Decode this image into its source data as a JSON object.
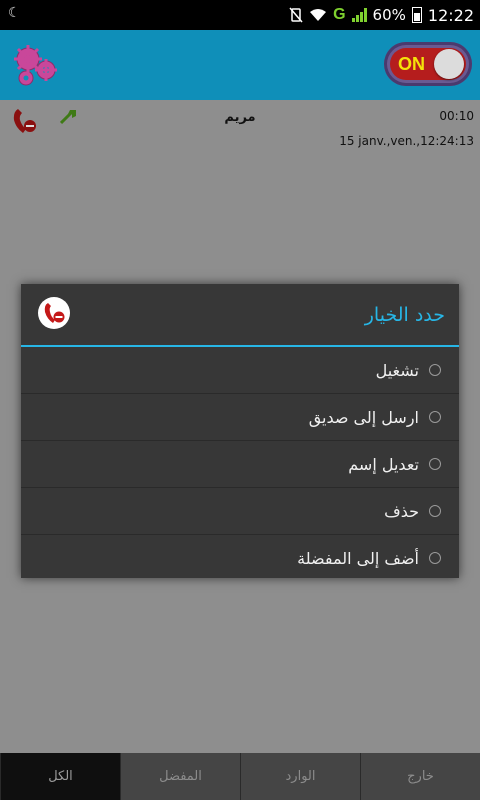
{
  "status_bar": {
    "left_icon": "moon-icon",
    "battery_percent": "60%",
    "network": "G",
    "time": "12:22"
  },
  "toolbar": {
    "switch_label": "ON",
    "switch_on": true,
    "settings_icon": "gears-icon"
  },
  "call": {
    "name": "مريم",
    "duration": "00:10",
    "datetime": "15 janv.,ven.,12:24:13"
  },
  "dialog": {
    "title": "حدد الخيار",
    "options": [
      {
        "label": "تشغيل"
      },
      {
        "label": "ارسل إلى صديق"
      },
      {
        "label": "تعديل إسم"
      },
      {
        "label": "حذف"
      },
      {
        "label": "أضف إلى المفضلة"
      }
    ]
  },
  "tabs": [
    {
      "label": "الكل",
      "active": true
    },
    {
      "label": "المفضل",
      "active": false
    },
    {
      "label": "الوارد",
      "active": false
    },
    {
      "label": "خارج",
      "active": false
    }
  ],
  "colors": {
    "toolbar": "#0f8fb9",
    "accent": "#27b6e6",
    "switch_track": "#b51d1d",
    "switch_text": "#f4e20a"
  }
}
